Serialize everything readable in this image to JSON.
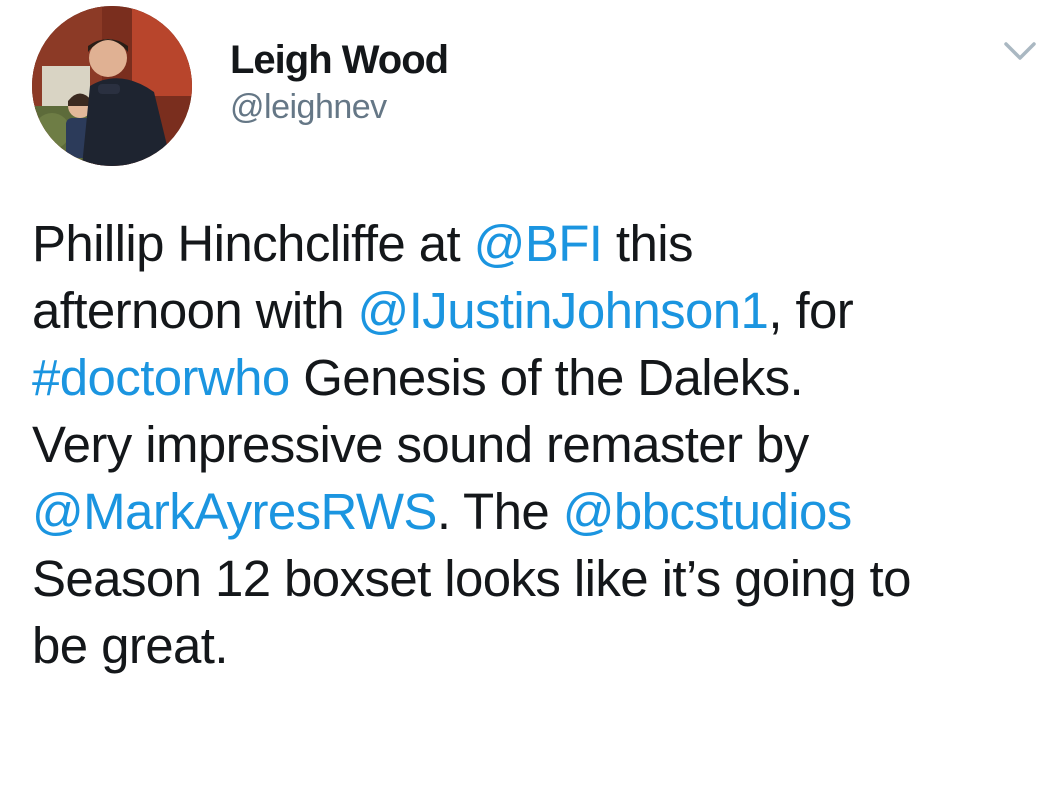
{
  "author": {
    "display_name": "Leigh Wood",
    "handle": "@leighnev"
  },
  "menu": {
    "icon": "chevron-down-icon"
  },
  "tweet": {
    "line1": {
      "t1": "Phillip Hinchcliffe at ",
      "m1": "@BFI",
      "t2": " this"
    },
    "line2": {
      "t1": "afternoon with ",
      "m1": "@IJustinJohnson1",
      "t2": ", for"
    },
    "line3": {
      "h1": "#doctorwho",
      "t1": " Genesis of the Daleks."
    },
    "line4": {
      "t1": "Very impressive sound remaster by"
    },
    "line5": {
      "m1": "@MarkAyresRWS",
      "t1": ". The ",
      "m2": "@bbcstudios"
    },
    "line6": {
      "t1": "Season 12 boxset looks like it’s going to"
    },
    "line7": {
      "t1": "be great."
    }
  },
  "colors": {
    "link": "#1b95e0",
    "text": "#14171a",
    "secondary": "#657786",
    "caret": "#aab8c2"
  }
}
